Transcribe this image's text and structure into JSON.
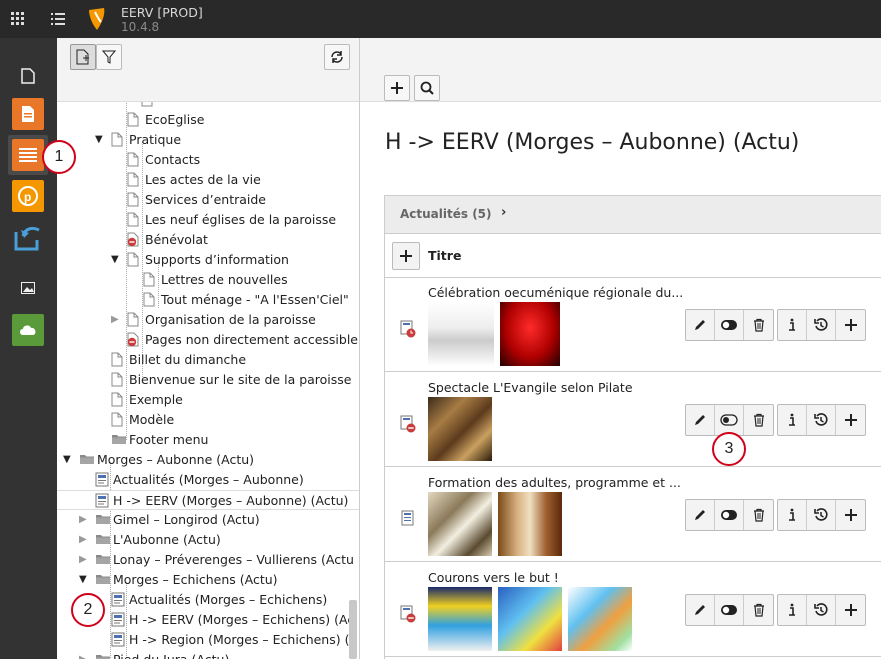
{
  "topbar": {
    "site_name": "EERV [PROD]",
    "site_version": "10.4.8"
  },
  "callouts": [
    "1",
    "2",
    "3"
  ],
  "tree": {
    "nodes": [
      {
        "label": "EcoEglise",
        "type": "page"
      },
      {
        "label": "Pratique",
        "type": "page"
      },
      {
        "label": "Contacts",
        "type": "page"
      },
      {
        "label": "Les actes de la vie",
        "type": "page"
      },
      {
        "label": "Services d’entraide",
        "type": "page"
      },
      {
        "label": "Les neuf églises de la paroisse",
        "type": "page"
      },
      {
        "label": "Bénévolat",
        "type": "restricted"
      },
      {
        "label": "Supports d’information",
        "type": "page"
      },
      {
        "label": "Lettres de nouvelles",
        "type": "page"
      },
      {
        "label": "Tout ménage - \"A l'Essen'Ciel\"",
        "type": "page"
      },
      {
        "label": "Organisation de la paroisse",
        "type": "page"
      },
      {
        "label": "Pages non directement accessible",
        "type": "restricted"
      },
      {
        "label": "Billet du dimanche",
        "type": "page"
      },
      {
        "label": "Bienvenue sur le site de la paroisse",
        "type": "page"
      },
      {
        "label": "Exemple",
        "type": "page"
      },
      {
        "label": "Modèle",
        "type": "page"
      },
      {
        "label": "Footer menu",
        "type": "folder"
      },
      {
        "label": "Morges – Aubonne (Actu)",
        "type": "folder"
      },
      {
        "label": "Actualités (Morges – Aubonne)",
        "type": "news"
      },
      {
        "label": "H -> EERV (Morges – Aubonne) (Actu)",
        "type": "news"
      },
      {
        "label": "Gimel – Longirod (Actu)",
        "type": "folder"
      },
      {
        "label": "L'Aubonne (Actu)",
        "type": "folder"
      },
      {
        "label": "Lonay – Préverenges – Vullierens (Actu",
        "type": "folder"
      },
      {
        "label": "Morges – Echichens (Actu)",
        "type": "folder"
      },
      {
        "label": "Actualités (Morges – Echichens)",
        "type": "news"
      },
      {
        "label": "H -> EERV (Morges – Echichens) (Ac",
        "type": "news"
      },
      {
        "label": "H -> Region (Morges – Echichens) (",
        "type": "news"
      },
      {
        "label": "Pied du Jura (Actu)",
        "type": "folder"
      }
    ]
  },
  "main": {
    "page_title": "H -> EERV (Morges – Aubonne) (Actu)",
    "panel_label": "Actualités (5)",
    "column_title": "Titre",
    "records": [
      {
        "title": "Célébration oecuménique régionale du...",
        "icon": "news-scheduled-icon"
      },
      {
        "title": "Spectacle L'Evangile selon Pilate",
        "icon": "news-restricted-icon"
      },
      {
        "title": "Formation des adultes, programme et ...",
        "icon": "news-icon"
      },
      {
        "title": "Courons vers le but !",
        "icon": "news-restricted-icon"
      }
    ]
  },
  "colors": {
    "topbar": "#292929",
    "modmenu": "#333333",
    "accent_orange": "#e8772a",
    "callout_red": "#d0021b"
  }
}
